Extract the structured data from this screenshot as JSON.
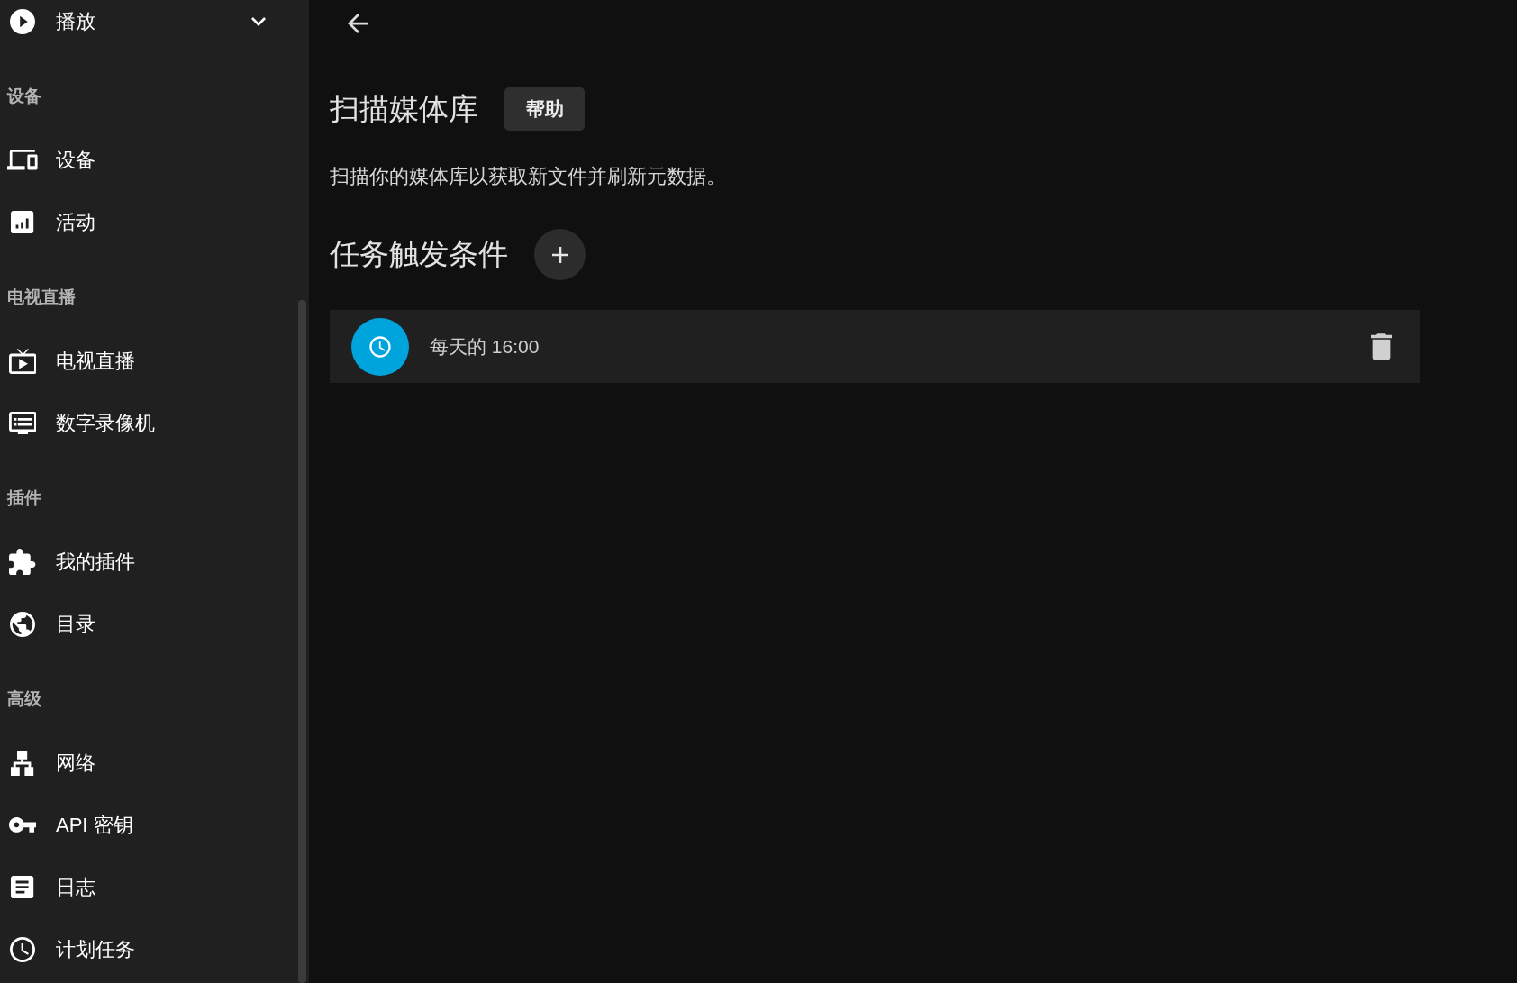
{
  "sidebar": {
    "header": {
      "label": "播放"
    },
    "sections": [
      {
        "title": "设备",
        "items": [
          {
            "label": "设备",
            "selected": false
          },
          {
            "label": "活动",
            "selected": false
          }
        ]
      },
      {
        "title": "电视直播",
        "items": [
          {
            "label": "电视直播",
            "selected": false
          },
          {
            "label": "数字录像机",
            "selected": false
          }
        ]
      },
      {
        "title": "插件",
        "items": [
          {
            "label": "我的插件",
            "selected": false
          },
          {
            "label": "目录",
            "selected": false
          }
        ]
      },
      {
        "title": "高级",
        "items": [
          {
            "label": "网络",
            "selected": false
          },
          {
            "label": "API 密钥",
            "selected": false
          },
          {
            "label": "日志",
            "selected": false
          },
          {
            "label": "计划任务",
            "selected": false
          }
        ]
      }
    ]
  },
  "page": {
    "title": "扫描媒体库",
    "help_button": "帮助",
    "description": "扫描你的媒体库以获取新文件并刷新元数据。",
    "triggers_heading": "任务触发条件",
    "triggers": [
      {
        "label": "每天的 16:00"
      }
    ]
  }
}
